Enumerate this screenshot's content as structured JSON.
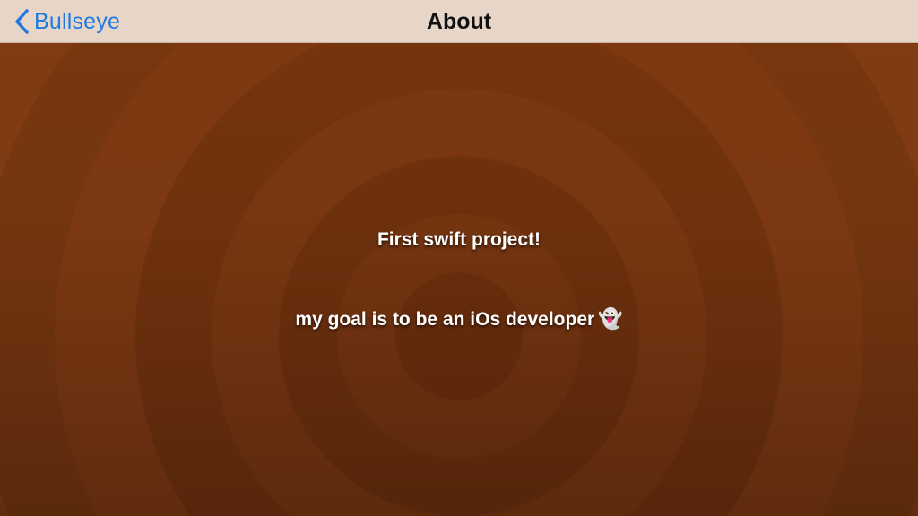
{
  "nav": {
    "back_label": "Bullseye",
    "title": "About",
    "back_color": "#1f7ae0"
  },
  "content": {
    "line1": "First swift project!",
    "line2": "my goal is to be an iOs developer",
    "emoji": "👻",
    "emoji_name": "ghost-icon"
  },
  "colors": {
    "navbar_bg": "#e7d5c8",
    "background": "#6f310e"
  }
}
